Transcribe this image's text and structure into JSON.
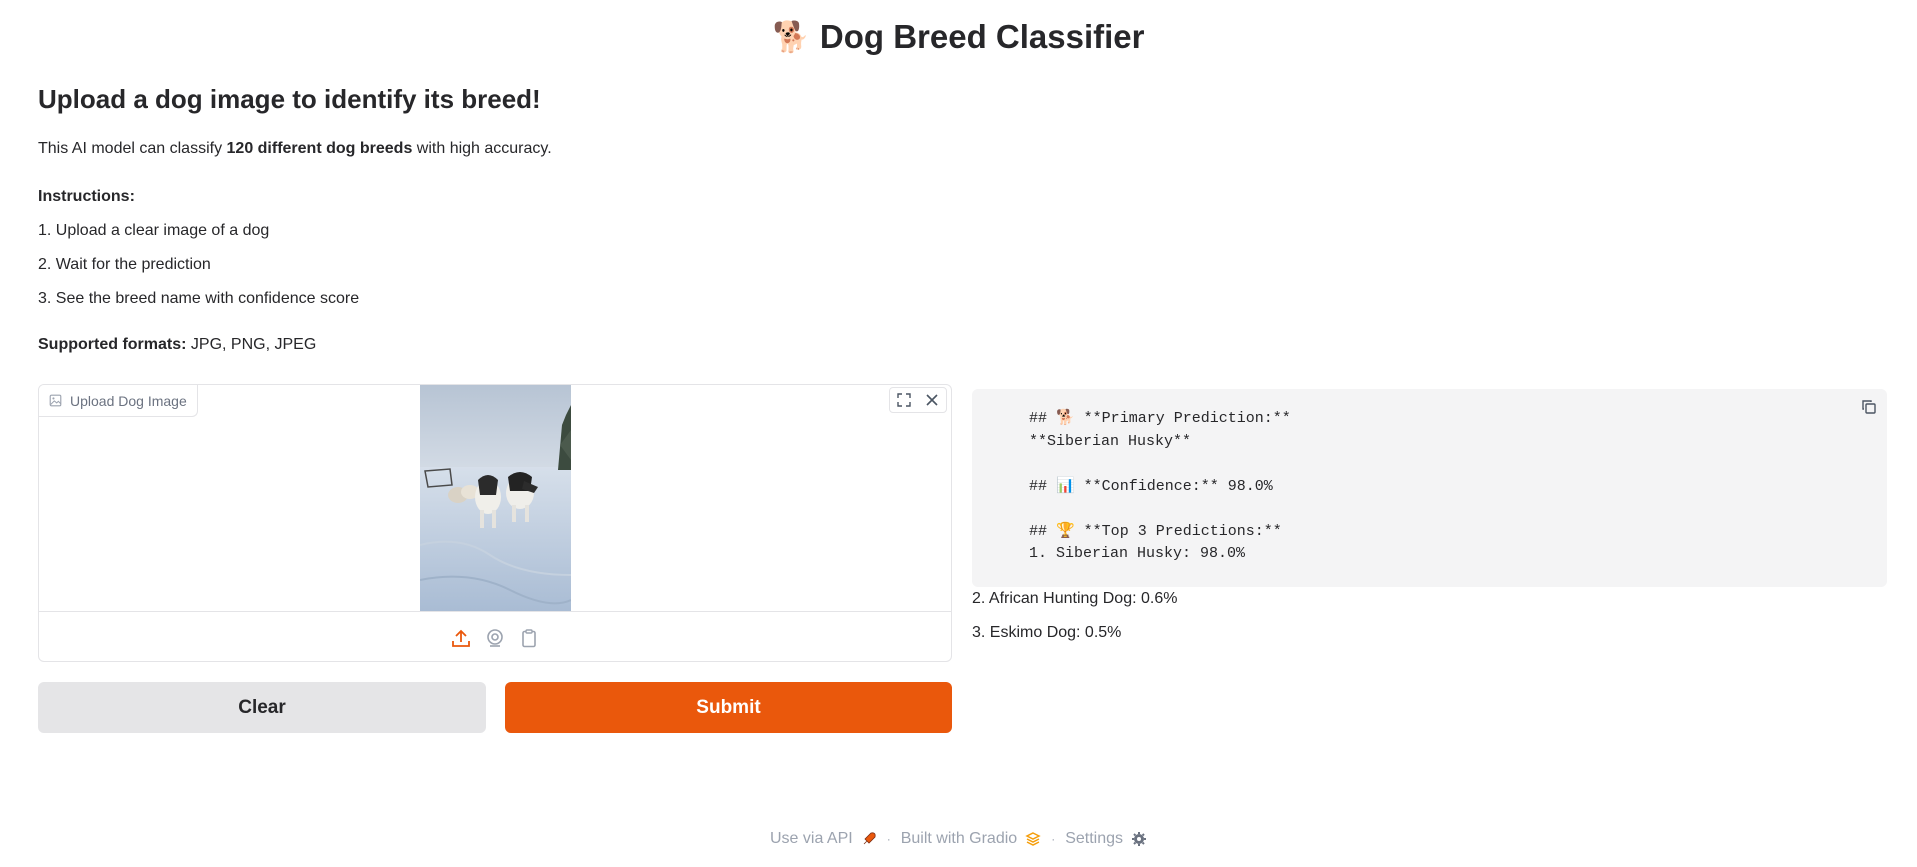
{
  "app": {
    "title": "Dog Breed Classifier",
    "title_emoji": "🐕"
  },
  "intro": {
    "heading": "Upload a dog image to identify its breed!",
    "desc_prefix": "This AI model can classify ",
    "desc_bold": "120 different dog breeds",
    "desc_suffix": " with high accuracy.",
    "instructions_heading": "Instructions:",
    "steps": [
      "1. Upload a clear image of a dog",
      "2. Wait for the prediction",
      "3. See the breed name with confidence score"
    ],
    "formats_label": "Supported formats:",
    "formats_value": " JPG, PNG, JPEG"
  },
  "upload": {
    "label": "Upload Dog Image",
    "icons": [
      "upload-icon",
      "webcam-icon",
      "clipboard-icon"
    ]
  },
  "buttons": {
    "clear": "Clear",
    "submit": "Submit"
  },
  "output": {
    "code_text": "## 🐕 **Primary Prediction:**\n**Siberian Husky**\n\n## 📊 **Confidence:** 98.0%\n\n## 🏆 **Top 3 Predictions:**\n1. Siberian Husky: 98.0%",
    "extra": [
      "2. African Hunting Dog: 0.6%",
      "3. Eskimo Dog: 0.5%"
    ]
  },
  "footer": {
    "api": "Use via API",
    "built": "Built with Gradio",
    "settings": "Settings",
    "separator": "·"
  },
  "colors": {
    "accent": "#ea580c",
    "neutral_button": "#e5e5e7",
    "code_bg": "#f4f4f5"
  }
}
